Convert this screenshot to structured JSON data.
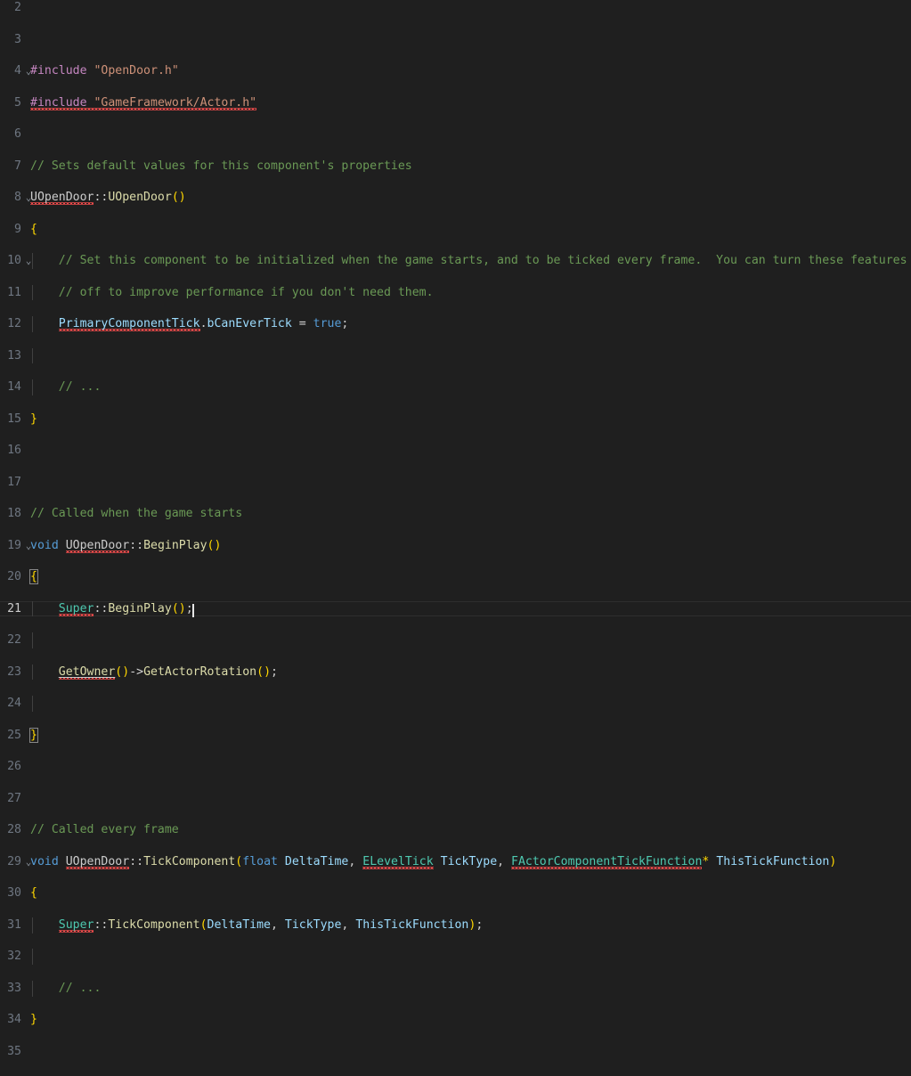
{
  "editor": {
    "language": "cpp",
    "theme": "Dark Modern",
    "background_color": "#1f1f1f",
    "foreground_color": "#cccccc",
    "line_number_color": "#6e7681",
    "active_line_number_color": "#cccccc",
    "cursor_color": "#e6e6e6",
    "error_squiggle_color": "#f14c4c",
    "indent_guide_color": "#404040",
    "active_line_number": 21,
    "cursor_line": 21,
    "cursor_column": 23,
    "first_visible_line": 2,
    "last_visible_line": 35
  },
  "lines": [
    {
      "n": "2",
      "fold": "",
      "text": ""
    },
    {
      "n": "3",
      "fold": "",
      "text": ""
    },
    {
      "n": "4",
      "fold": "v",
      "text": "#include \"OpenDoor.h\""
    },
    {
      "n": "5",
      "fold": "",
      "text": "#include \"GameFramework/Actor.h\""
    },
    {
      "n": "6",
      "fold": "",
      "text": ""
    },
    {
      "n": "7",
      "fold": "",
      "text": "// Sets default values for this component's properties"
    },
    {
      "n": "8",
      "fold": "v",
      "text": "UOpenDoor::UOpenDoor()"
    },
    {
      "n": "9",
      "fold": "",
      "text": "{"
    },
    {
      "n": "10",
      "fold": "v",
      "text": "    // Set this component to be initialized when the game starts, and to be ticked every frame.  You can turn these features"
    },
    {
      "n": "11",
      "fold": "",
      "text": "    // off to improve performance if you don't need them."
    },
    {
      "n": "12",
      "fold": "",
      "text": "    PrimaryComponentTick.bCanEverTick = true;"
    },
    {
      "n": "13",
      "fold": "",
      "text": ""
    },
    {
      "n": "14",
      "fold": "",
      "text": "    // ..."
    },
    {
      "n": "15",
      "fold": "",
      "text": "}"
    },
    {
      "n": "16",
      "fold": "",
      "text": ""
    },
    {
      "n": "17",
      "fold": "",
      "text": ""
    },
    {
      "n": "18",
      "fold": "",
      "text": "// Called when the game starts"
    },
    {
      "n": "19",
      "fold": "v",
      "text": "void UOpenDoor::BeginPlay()"
    },
    {
      "n": "20",
      "fold": "",
      "text": "{"
    },
    {
      "n": "21",
      "fold": "",
      "text": "    Super::BeginPlay();"
    },
    {
      "n": "22",
      "fold": "",
      "text": ""
    },
    {
      "n": "23",
      "fold": "",
      "text": "    GetOwner()->GetActorRotation();"
    },
    {
      "n": "24",
      "fold": "",
      "text": ""
    },
    {
      "n": "25",
      "fold": "",
      "text": "}"
    },
    {
      "n": "26",
      "fold": "",
      "text": ""
    },
    {
      "n": "27",
      "fold": "",
      "text": ""
    },
    {
      "n": "28",
      "fold": "",
      "text": "// Called every frame"
    },
    {
      "n": "29",
      "fold": "v",
      "text": "void UOpenDoor::TickComponent(float DeltaTime, ELevelTick TickType, FActorComponentTickFunction* ThisTickFunction)"
    },
    {
      "n": "30",
      "fold": "",
      "text": "{"
    },
    {
      "n": "31",
      "fold": "",
      "text": "    Super::TickComponent(DeltaTime, TickType, ThisTickFunction);"
    },
    {
      "n": "32",
      "fold": "",
      "text": ""
    },
    {
      "n": "33",
      "fold": "",
      "text": "    // ..."
    },
    {
      "n": "34",
      "fold": "",
      "text": "}"
    },
    {
      "n": "35",
      "fold": "",
      "text": ""
    }
  ],
  "line_numbers": {
    "l2": "2",
    "l3": "3",
    "l4": "4",
    "l5": "5",
    "l6": "6",
    "l7": "7",
    "l8": "8",
    "l9": "9",
    "l10": "10",
    "l11": "11",
    "l12": "12",
    "l13": "13",
    "l14": "14",
    "l15": "15",
    "l16": "16",
    "l17": "17",
    "l18": "18",
    "l19": "19",
    "l20": "20",
    "l21": "21",
    "l22": "22",
    "l23": "23",
    "l24": "24",
    "l25": "25",
    "l26": "26",
    "l27": "27",
    "l28": "28",
    "l29": "29",
    "l30": "30",
    "l31": "31",
    "l32": "32",
    "l33": "33",
    "l34": "34",
    "l35": "35"
  },
  "fold_glyph": "⌄",
  "tokens": {
    "include_directive": "#include",
    "str_opendoor": "\"OpenDoor.h\"",
    "str_actor": "\"GameFramework/Actor.h\"",
    "comment_7": "// Sets default values for this component's properties",
    "ctor_class": "UOpenDoor",
    "scope_op": "::",
    "ctor_name": "UOpenDoor",
    "parens_empty": "()",
    "brace_open": "{",
    "brace_close": "}",
    "comment_10": "// Set this component to be initialized when the game starts, and to be ticked every frame.  You can turn these features",
    "comment_11": "// off to improve performance if you don't need them.",
    "primary_tick": "PrimaryComponentTick",
    "dot": ".",
    "can_ever_tick": "bCanEverTick",
    "assign": " = ",
    "kw_true": "true",
    "semi": ";",
    "comment_ellipsis": "// ...",
    "comment_18": "// Called when the game starts",
    "kw_void": "void",
    "class_uopendoor": "UOpenDoor",
    "fn_beginplay": "BeginPlay",
    "kw_super": "Super",
    "fn_getowner": "GetOwner",
    "arrow": "->",
    "fn_getactorrotation": "GetActorRotation",
    "comment_28": "// Called every frame",
    "fn_tickcomponent": "TickComponent",
    "kw_float": "float",
    "param_deltatime": "DeltaTime",
    "comma": ", ",
    "type_eleveltick": "ELevelTick",
    "param_ticktype": "TickType",
    "type_factorcomp": "FActorComponentTickFunction",
    "star": "*",
    "param_thistick": "ThisTickFunction",
    "paren_open": "(",
    "paren_close": ")"
  },
  "colors": {
    "comment": "#6a9955",
    "preprocessor": "#c586c0",
    "string": "#ce9178",
    "keyword": "#569cd6",
    "type": "#4ec9b0",
    "function": "#dcdcaa",
    "variable": "#9cdcfe",
    "plain": "#cccccc",
    "background": "#1f1f1f"
  }
}
